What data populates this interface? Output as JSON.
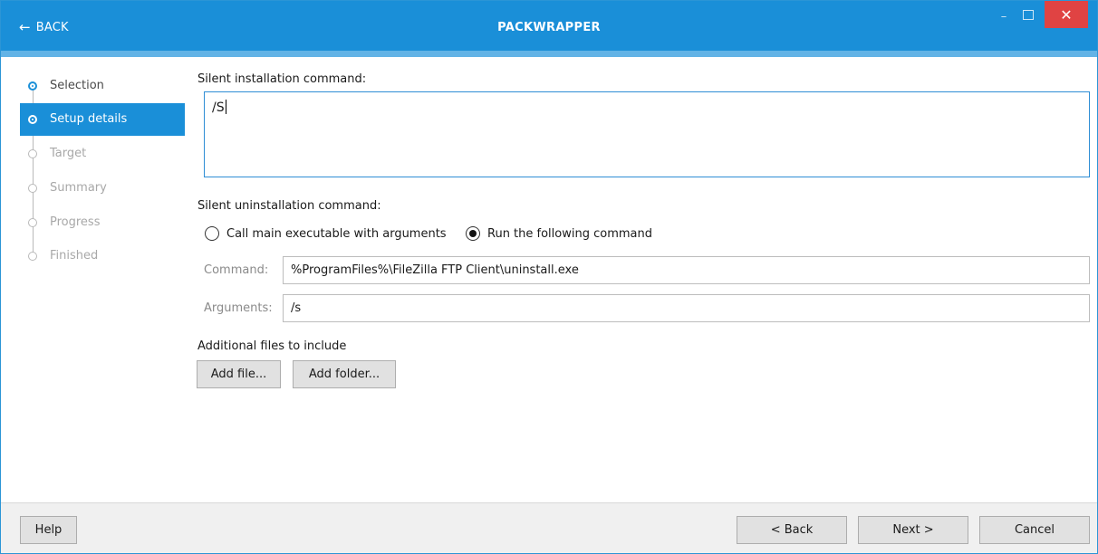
{
  "titlebar": {
    "back_label": "BACK",
    "title": "PACKWRAPPER"
  },
  "colors": {
    "accent": "#1a8fd8",
    "accent_light": "#62b3e6",
    "close": "#e04343"
  },
  "sidebar": {
    "steps": [
      {
        "label": "Selection",
        "state": "done"
      },
      {
        "label": "Setup details",
        "state": "active"
      },
      {
        "label": "Target",
        "state": "pending"
      },
      {
        "label": "Summary",
        "state": "pending"
      },
      {
        "label": "Progress",
        "state": "pending"
      },
      {
        "label": "Finished",
        "state": "pending"
      }
    ]
  },
  "main": {
    "install_label": "Silent installation command:",
    "install_value": "/S",
    "uninstall_label": "Silent uninstallation command:",
    "radio_call_main": "Call main executable with arguments",
    "radio_run_command": "Run the following command",
    "selected_radio": "run_command",
    "command_label": "Command:",
    "command_value": "%ProgramFiles%\\FileZilla FTP Client\\uninstall.exe",
    "arguments_label": "Arguments:",
    "arguments_value": "/s",
    "additional_files_label": "Additional files to include",
    "add_file_button": "Add file...",
    "add_folder_button": "Add folder..."
  },
  "footer": {
    "help": "Help",
    "back": "< Back",
    "next": "Next >",
    "cancel": "Cancel"
  }
}
